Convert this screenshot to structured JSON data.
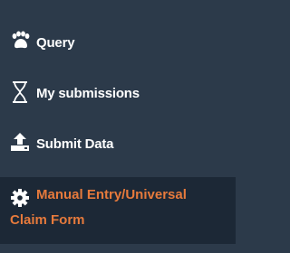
{
  "sidebar": {
    "items": [
      {
        "label": "Query",
        "icon": "paw-icon"
      },
      {
        "label": "My submissions",
        "icon": "hourglass-icon"
      },
      {
        "label": "Submit Data",
        "icon": "upload-icon"
      },
      {
        "label_line1": "Manual Entry/Universal",
        "label_line2": "Claim Form",
        "icon": "gear-icon",
        "active": true
      }
    ],
    "colors": {
      "background": "#2c3a4a",
      "active_background": "#1c2836",
      "text": "#ffffff",
      "active_text": "#e67a3c"
    }
  }
}
